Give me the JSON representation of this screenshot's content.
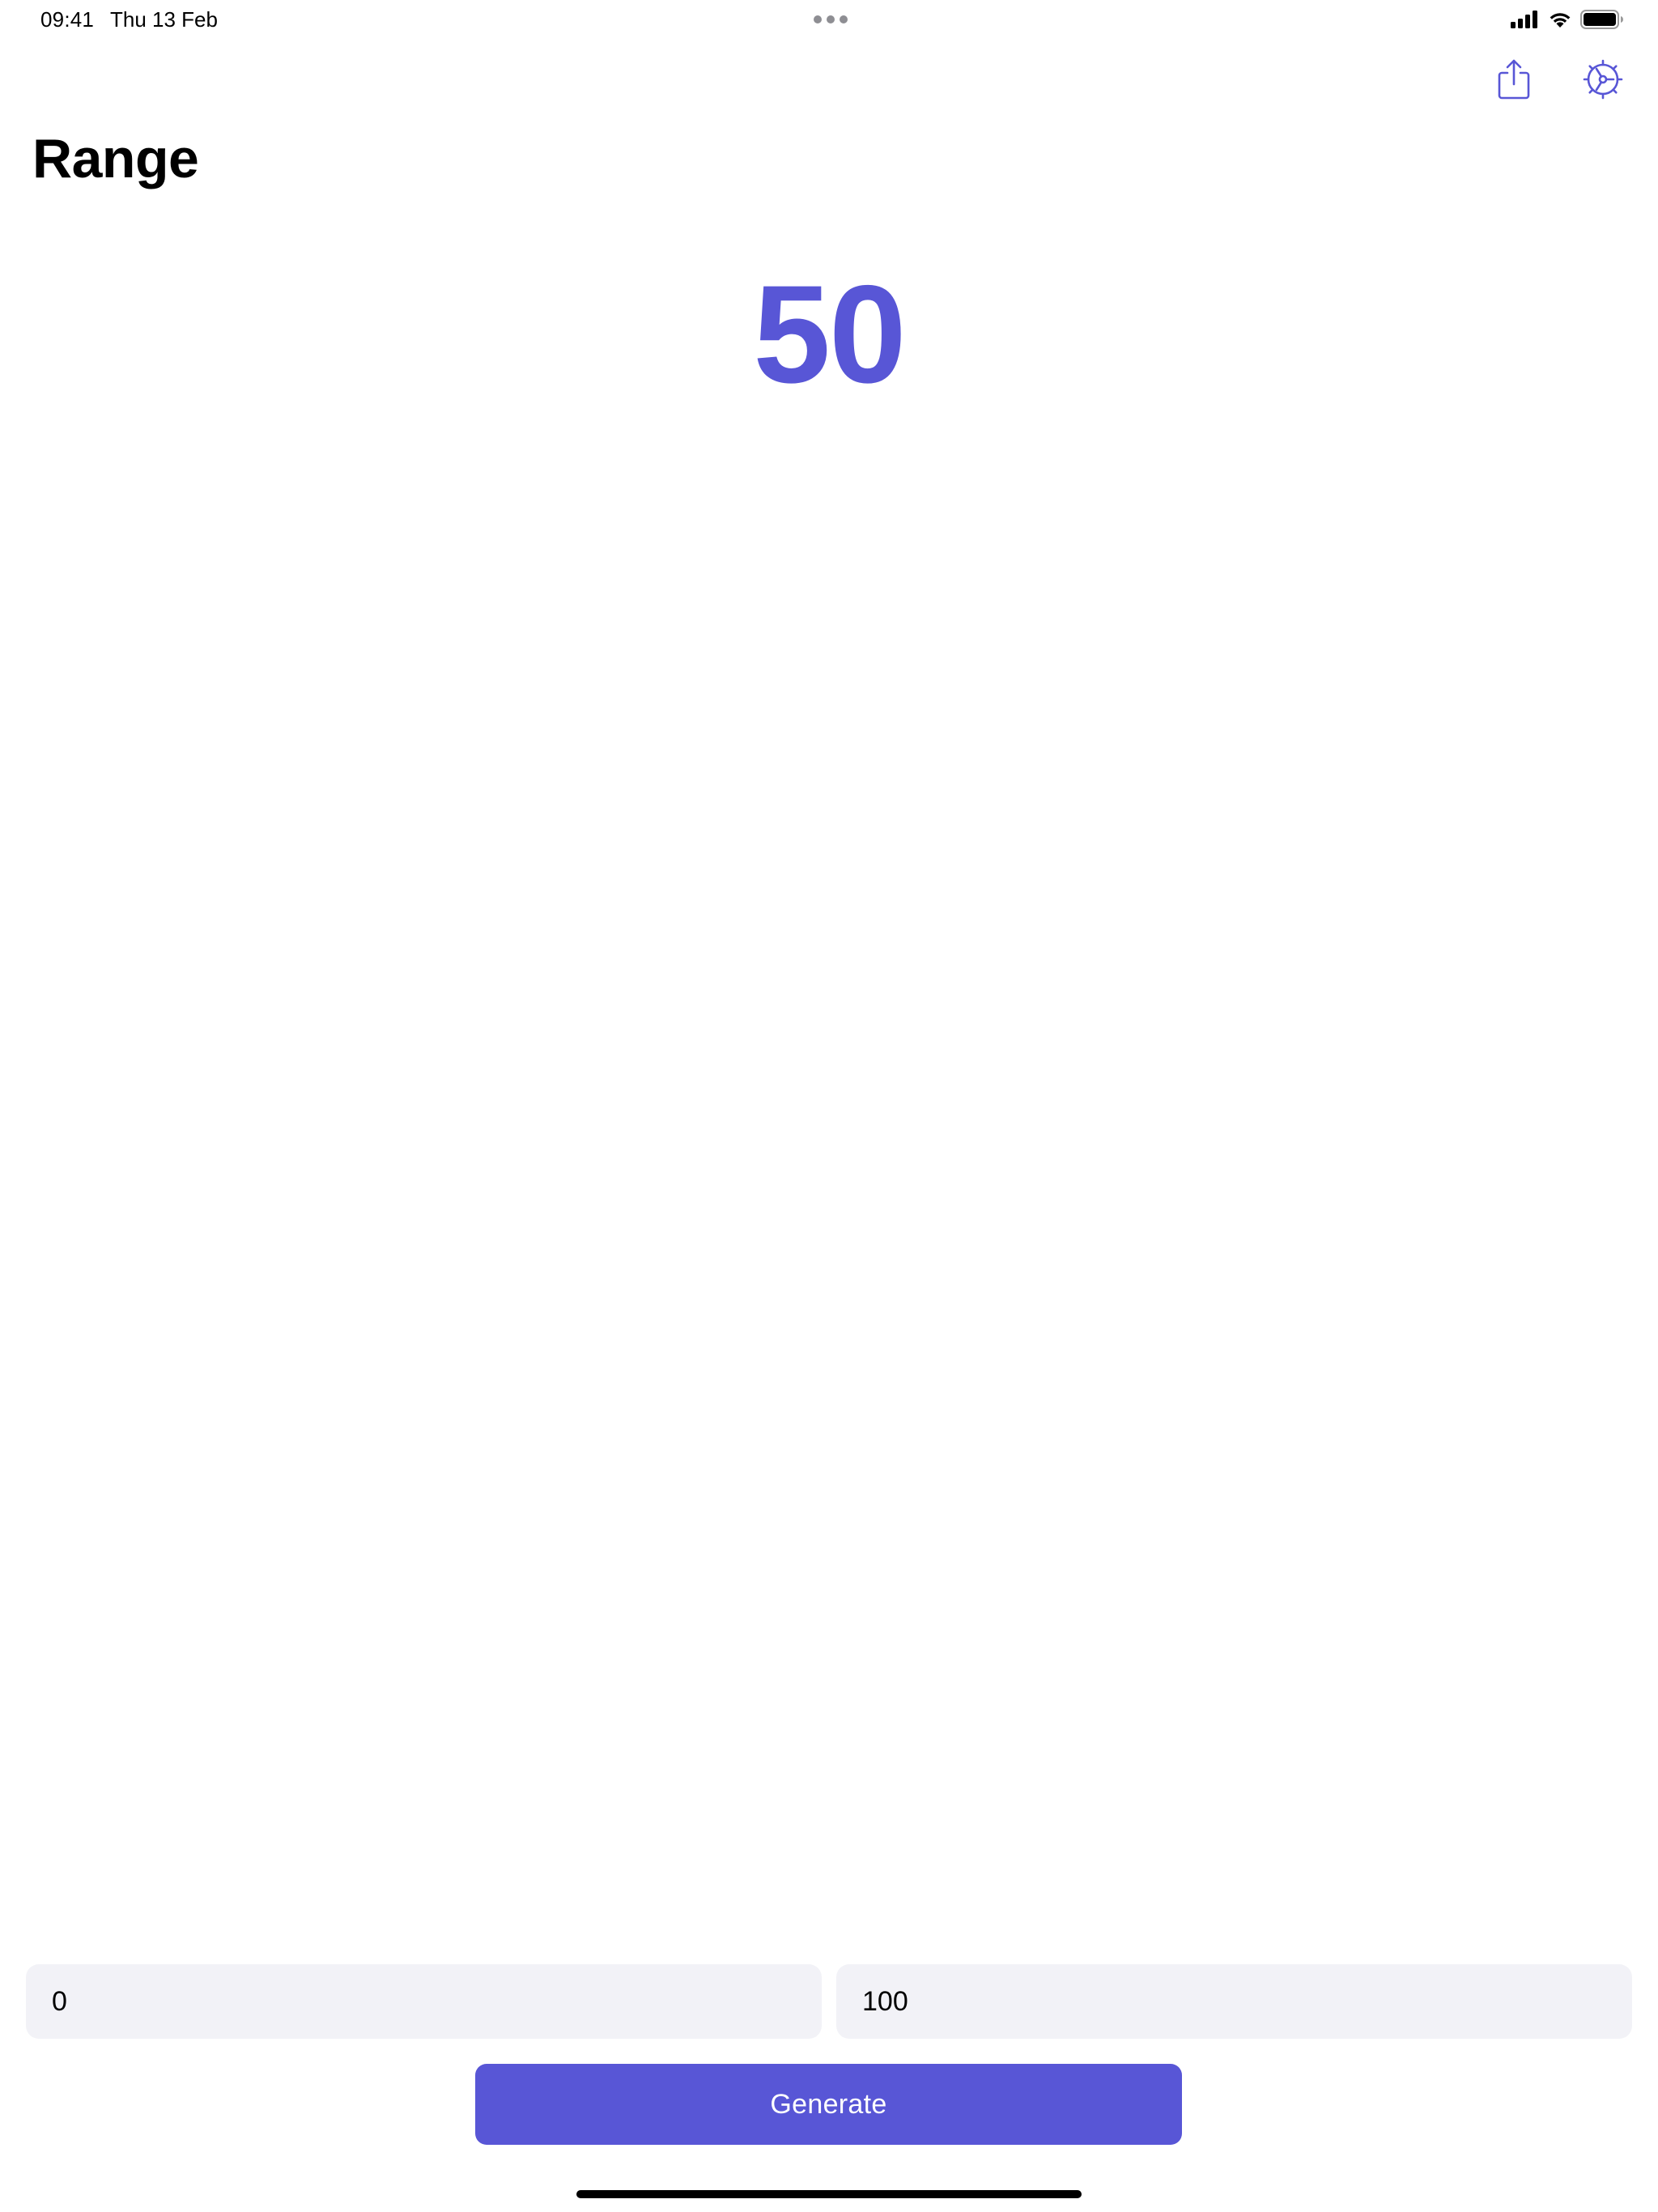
{
  "status_bar": {
    "time": "09:41",
    "date": "Thu 13 Feb",
    "icons": [
      "cellular-signal-icon",
      "wifi-icon",
      "battery-icon"
    ]
  },
  "toolbar": {
    "share_icon": "share-icon",
    "settings_icon": "gear-icon"
  },
  "page": {
    "title": "Range"
  },
  "result": {
    "value": "50"
  },
  "range": {
    "min_value": "0",
    "max_value": "100"
  },
  "actions": {
    "generate_label": "Generate"
  },
  "colors": {
    "accent": "#5856d6",
    "field_background": "#f2f2f7",
    "background": "#ffffff",
    "text": "#000000"
  }
}
